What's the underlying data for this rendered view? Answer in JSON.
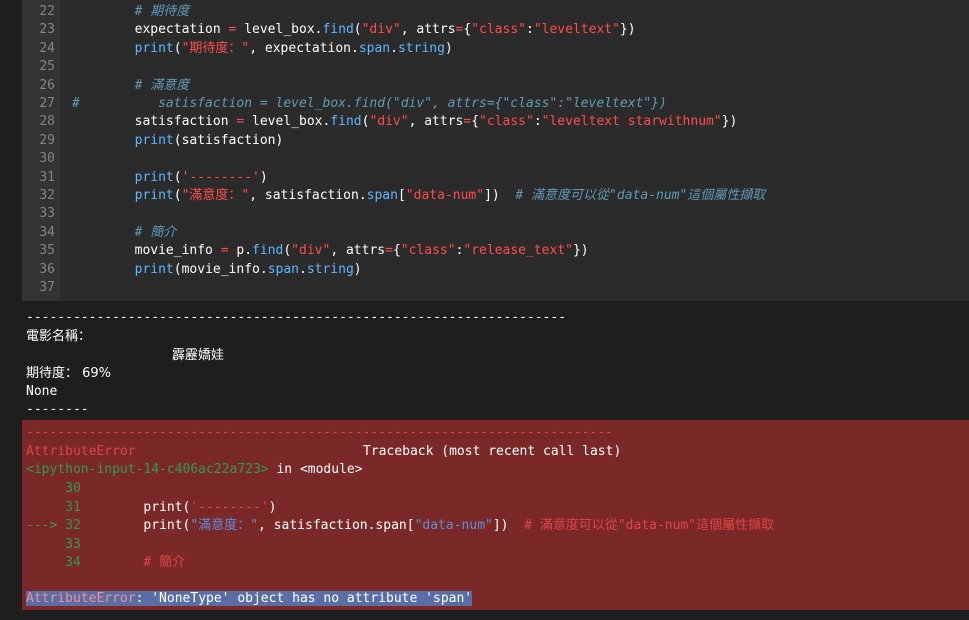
{
  "code_lines": [
    {
      "n": "22",
      "parts": [
        {
          "t": "        ",
          "c": ""
        },
        {
          "t": "# 期待度",
          "c": "cm"
        }
      ]
    },
    {
      "n": "23",
      "parts": [
        {
          "t": "        expectation ",
          "c": ""
        },
        {
          "t": "=",
          "c": "op"
        },
        {
          "t": " level_box.",
          "c": ""
        },
        {
          "t": "find",
          "c": "fn"
        },
        {
          "t": "(",
          "c": ""
        },
        {
          "t": "\"div\"",
          "c": "str"
        },
        {
          "t": ", attrs",
          "c": ""
        },
        {
          "t": "=",
          "c": "op"
        },
        {
          "t": "{",
          "c": ""
        },
        {
          "t": "\"class\"",
          "c": "str"
        },
        {
          "t": ":",
          "c": ""
        },
        {
          "t": "\"leveltext\"",
          "c": "str"
        },
        {
          "t": "})",
          "c": ""
        }
      ]
    },
    {
      "n": "24",
      "parts": [
        {
          "t": "        ",
          "c": ""
        },
        {
          "t": "print",
          "c": "fn"
        },
        {
          "t": "(",
          "c": ""
        },
        {
          "t": "\"期待度：\"",
          "c": "str"
        },
        {
          "t": ", expectation.",
          "c": ""
        },
        {
          "t": "span",
          "c": "fn"
        },
        {
          "t": ".",
          "c": ""
        },
        {
          "t": "string",
          "c": "fn"
        },
        {
          "t": ")",
          "c": ""
        }
      ]
    },
    {
      "n": "25",
      "parts": []
    },
    {
      "n": "26",
      "parts": [
        {
          "t": "        ",
          "c": ""
        },
        {
          "t": "# 滿意度",
          "c": "cm"
        }
      ]
    },
    {
      "n": "27",
      "parts": [
        {
          "t": "#",
          "c": "cm"
        },
        {
          "t": "          satisfaction = level_box.find(\"div\", attrs={\"class\":\"leveltext\"})",
          "c": "cm"
        }
      ]
    },
    {
      "n": "28",
      "parts": [
        {
          "t": "        satisfaction ",
          "c": ""
        },
        {
          "t": "=",
          "c": "op"
        },
        {
          "t": " level_box.",
          "c": ""
        },
        {
          "t": "find",
          "c": "fn"
        },
        {
          "t": "(",
          "c": ""
        },
        {
          "t": "\"div\"",
          "c": "str"
        },
        {
          "t": ", attrs",
          "c": ""
        },
        {
          "t": "=",
          "c": "op"
        },
        {
          "t": "{",
          "c": ""
        },
        {
          "t": "\"class\"",
          "c": "str"
        },
        {
          "t": ":",
          "c": ""
        },
        {
          "t": "\"leveltext starwithnum\"",
          "c": "str"
        },
        {
          "t": "})",
          "c": ""
        }
      ]
    },
    {
      "n": "29",
      "parts": [
        {
          "t": "        ",
          "c": ""
        },
        {
          "t": "print",
          "c": "fn"
        },
        {
          "t": "(satisfaction)",
          "c": ""
        }
      ]
    },
    {
      "n": "30",
      "parts": []
    },
    {
      "n": "31",
      "parts": [
        {
          "t": "        ",
          "c": ""
        },
        {
          "t": "print",
          "c": "fn"
        },
        {
          "t": "(",
          "c": ""
        },
        {
          "t": "'--------'",
          "c": "str"
        },
        {
          "t": ")",
          "c": ""
        }
      ]
    },
    {
      "n": "32",
      "parts": [
        {
          "t": "        ",
          "c": ""
        },
        {
          "t": "print",
          "c": "fn"
        },
        {
          "t": "(",
          "c": ""
        },
        {
          "t": "\"滿意度：\"",
          "c": "str"
        },
        {
          "t": ", satisfaction.",
          "c": ""
        },
        {
          "t": "span",
          "c": "fn"
        },
        {
          "t": "[",
          "c": ""
        },
        {
          "t": "\"data-num\"",
          "c": "str"
        },
        {
          "t": "])  ",
          "c": ""
        },
        {
          "t": "# 滿意度可以從\"data-num\"這個屬性擷取",
          "c": "cm"
        }
      ]
    },
    {
      "n": "33",
      "parts": []
    },
    {
      "n": "34",
      "parts": [
        {
          "t": "        ",
          "c": ""
        },
        {
          "t": "# 簡介",
          "c": "cm"
        }
      ]
    },
    {
      "n": "35",
      "parts": [
        {
          "t": "        movie_info ",
          "c": ""
        },
        {
          "t": "=",
          "c": "op"
        },
        {
          "t": " p.",
          "c": ""
        },
        {
          "t": "find",
          "c": "fn"
        },
        {
          "t": "(",
          "c": ""
        },
        {
          "t": "\"div\"",
          "c": "str"
        },
        {
          "t": ", attrs",
          "c": ""
        },
        {
          "t": "=",
          "c": "op"
        },
        {
          "t": "{",
          "c": ""
        },
        {
          "t": "\"class\"",
          "c": "str"
        },
        {
          "t": ":",
          "c": ""
        },
        {
          "t": "\"release_text\"",
          "c": "str"
        },
        {
          "t": "})",
          "c": ""
        }
      ]
    },
    {
      "n": "36",
      "parts": [
        {
          "t": "        ",
          "c": ""
        },
        {
          "t": "print",
          "c": "fn"
        },
        {
          "t": "(movie_info.",
          "c": ""
        },
        {
          "t": "span",
          "c": "fn"
        },
        {
          "t": ".",
          "c": ""
        },
        {
          "t": "string",
          "c": "fn"
        },
        {
          "t": ")",
          "c": ""
        }
      ]
    },
    {
      "n": "37",
      "parts": []
    }
  ],
  "output": {
    "dashes": "---------------------------------------------------------------------",
    "movie_name_label": "電影名稱：",
    "movie_name": "霹靂嬌娃",
    "expectation_line": "期待度： 69%",
    "none_line": "None",
    "separator": "--------"
  },
  "error": {
    "dashes": "---------------------------------------------------------------------------",
    "name": "AttributeError",
    "traceback_label": "Traceback (most recent call last)",
    "input_ref": "<ipython-input-14-c406ac22a723>",
    "in_module": " in <module>",
    "lines": [
      {
        "marker": "     30",
        "parts": []
      },
      {
        "marker": "     31",
        "parts": [
          {
            "t": "        print(",
            "c": "white"
          },
          {
            "t": "'--------'",
            "c": "red"
          },
          {
            "t": ")",
            "c": "white"
          }
        ]
      },
      {
        "marker": "---> 32",
        "parts": [
          {
            "t": "        print(",
            "c": "white"
          },
          {
            "t": "\"滿意度：\"",
            "c": "blue"
          },
          {
            "t": ", satisfaction.span[",
            "c": "white"
          },
          {
            "t": "\"data-num\"",
            "c": "blue"
          },
          {
            "t": "])  ",
            "c": "white"
          },
          {
            "t": "# 滿意度可以從\"data-num\"這個屬性擷取",
            "c": "red"
          }
        ]
      },
      {
        "marker": "     33",
        "parts": []
      },
      {
        "marker": "     34",
        "parts": [
          {
            "t": "        ",
            "c": "white"
          },
          {
            "t": "# 簡介",
            "c": "red"
          }
        ]
      }
    ],
    "message": ": 'NoneType' object has no attribute 'span'"
  }
}
